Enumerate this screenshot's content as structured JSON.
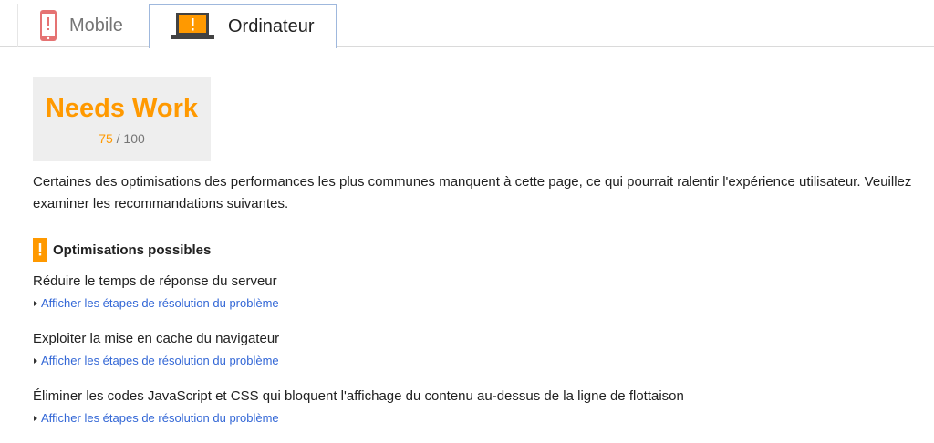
{
  "tabs": [
    {
      "label": "Mobile",
      "icon": "phone-icon",
      "active": false
    },
    {
      "label": "Ordinateur",
      "icon": "laptop-icon",
      "active": true
    }
  ],
  "score": {
    "label": "Needs Work",
    "value": "75",
    "max": "/ 100",
    "color": "#ff9900"
  },
  "summary": "Certaines des optimisations des performances les plus communes manquent à cette page, ce qui pourrait ralentir l'expérience utilisateur. Veuillez examiner les recommandations suivantes.",
  "section": {
    "title": "Optimisations possibles",
    "icon": "warning-icon"
  },
  "rules": [
    {
      "title": "Réduire le temps de réponse du serveur",
      "link": "Afficher les étapes de résolution du problème"
    },
    {
      "title": "Exploiter la mise en cache du navigateur",
      "link": "Afficher les étapes de résolution du problème"
    },
    {
      "title": "Éliminer les codes JavaScript et CSS qui bloquent l'affichage du contenu au-dessus de la ligne de flottaison",
      "link": "Afficher les étapes de résolution du problème"
    }
  ],
  "colors": {
    "accent": "#ff9900",
    "link": "#3367d6",
    "phone": "#e57373"
  }
}
